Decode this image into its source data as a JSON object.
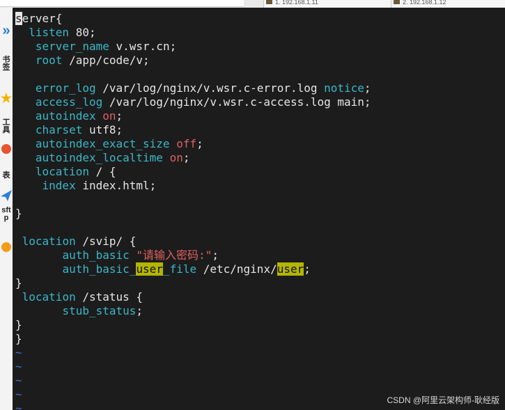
{
  "tabs": [
    {
      "label": "1. 192.168.1.11"
    },
    {
      "label": "2. 192.168.1.12"
    }
  ],
  "sidebar": {
    "items": [
      {
        "icon": "chevron-right-icon",
        "label": "»"
      },
      {
        "icon": "text",
        "label": "书签"
      },
      {
        "icon": "star-icon",
        "label": "★"
      },
      {
        "icon": "text",
        "label": "工具"
      },
      {
        "icon": "app-icon",
        "label": ""
      },
      {
        "icon": "text",
        "label": "表"
      },
      {
        "icon": "send-icon",
        "label": ""
      },
      {
        "icon": "text",
        "label": "sftp"
      },
      {
        "icon": "app-icon",
        "label": ""
      }
    ]
  },
  "code": {
    "l1_cursor": "s",
    "l1_rest": "erver{",
    "l2_kw": "listen",
    "l2_rest": " 80;",
    "l3_kw": "server_name",
    "l3_rest": " v.wsr.cn;",
    "l4_kw": "root",
    "l4_rest": " /app/code/v;",
    "l6_kw": "error_log",
    "l6_rest": " /var/log/nginx/v.wsr.c-error.log ",
    "l6_kw2": "notice",
    "l6_end": ";",
    "l7_kw": "access_log",
    "l7_rest": " /var/log/nginx/v.wsr.c-access.log main;",
    "l8_kw": "autoindex",
    "l8_val": "on",
    "l8_end": ";",
    "l9_kw": "charset",
    "l9_rest": " utf8;",
    "l10_kw": "autoindex_exact_size",
    "l10_val": "off",
    "l10_end": ";",
    "l11_kw": "autoindex_localtime",
    "l11_val": "on",
    "l11_end": ";",
    "l12_kw": "location",
    "l12_rest": " / {",
    "l13_kw": "index",
    "l13_rest": " index.html;",
    "l15": "}",
    "l17_kw": "location",
    "l17_rest": " /svip/ {",
    "l18_kw": "auth_basic",
    "l18_str": "\"请输入密码:\"",
    "l18_end": ";",
    "l19_kw1": "auth_basic_",
    "l19_hl1": "user",
    "l19_kw2": "_file",
    "l19_rest": " /etc/nginx/",
    "l19_hl2": "user",
    "l19_end": ";",
    "l20": "}",
    "l21_kw": "location",
    "l21_rest": " /status {",
    "l22_kw": "stub_status",
    "l22_end": ";",
    "l23": "}",
    "l24": "}",
    "tilde": "~"
  },
  "watermark": "CSDN @阿里云架构师-耿经版",
  "colors": {
    "background": "#1c1c1c",
    "keyword": "#3ab7c8",
    "value_red": "#e06060",
    "search_highlight": "#b5b500",
    "tilde": "#3f6fd0"
  }
}
